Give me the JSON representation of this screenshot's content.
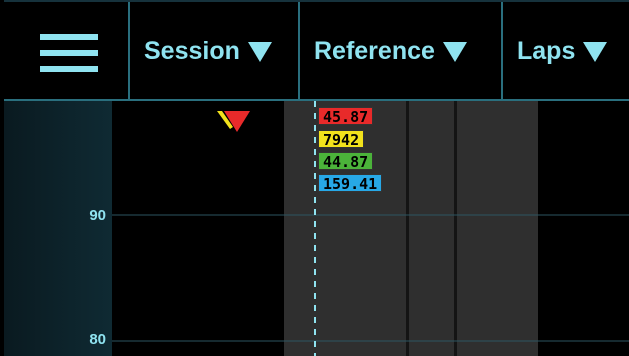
{
  "toolbar": {
    "menu_icon": "hamburger-icon",
    "session_label": "Session",
    "reference_label": "Reference",
    "laps_label": "Laps",
    "dropdown_icon": "triangle-down-icon",
    "accent_color": "#8fe3f0"
  },
  "axis": {
    "ticks": [
      {
        "label": "90",
        "value": 90
      },
      {
        "label": "80",
        "value": 80
      }
    ]
  },
  "cursor": {
    "readouts": [
      {
        "value": "45.87",
        "color": "#e82a2a",
        "text_color": "#000000"
      },
      {
        "value": "7942",
        "color": "#f2e21c",
        "text_color": "#000000"
      },
      {
        "value": "44.87",
        "color": "#4bb33a",
        "text_color": "#000000"
      },
      {
        "value": "159.41",
        "color": "#27a8e6",
        "text_color": "#000000"
      }
    ]
  },
  "marker": {
    "icon": "lap-marker-icon",
    "colors": [
      "#e82a2a",
      "#f2e21c"
    ]
  }
}
